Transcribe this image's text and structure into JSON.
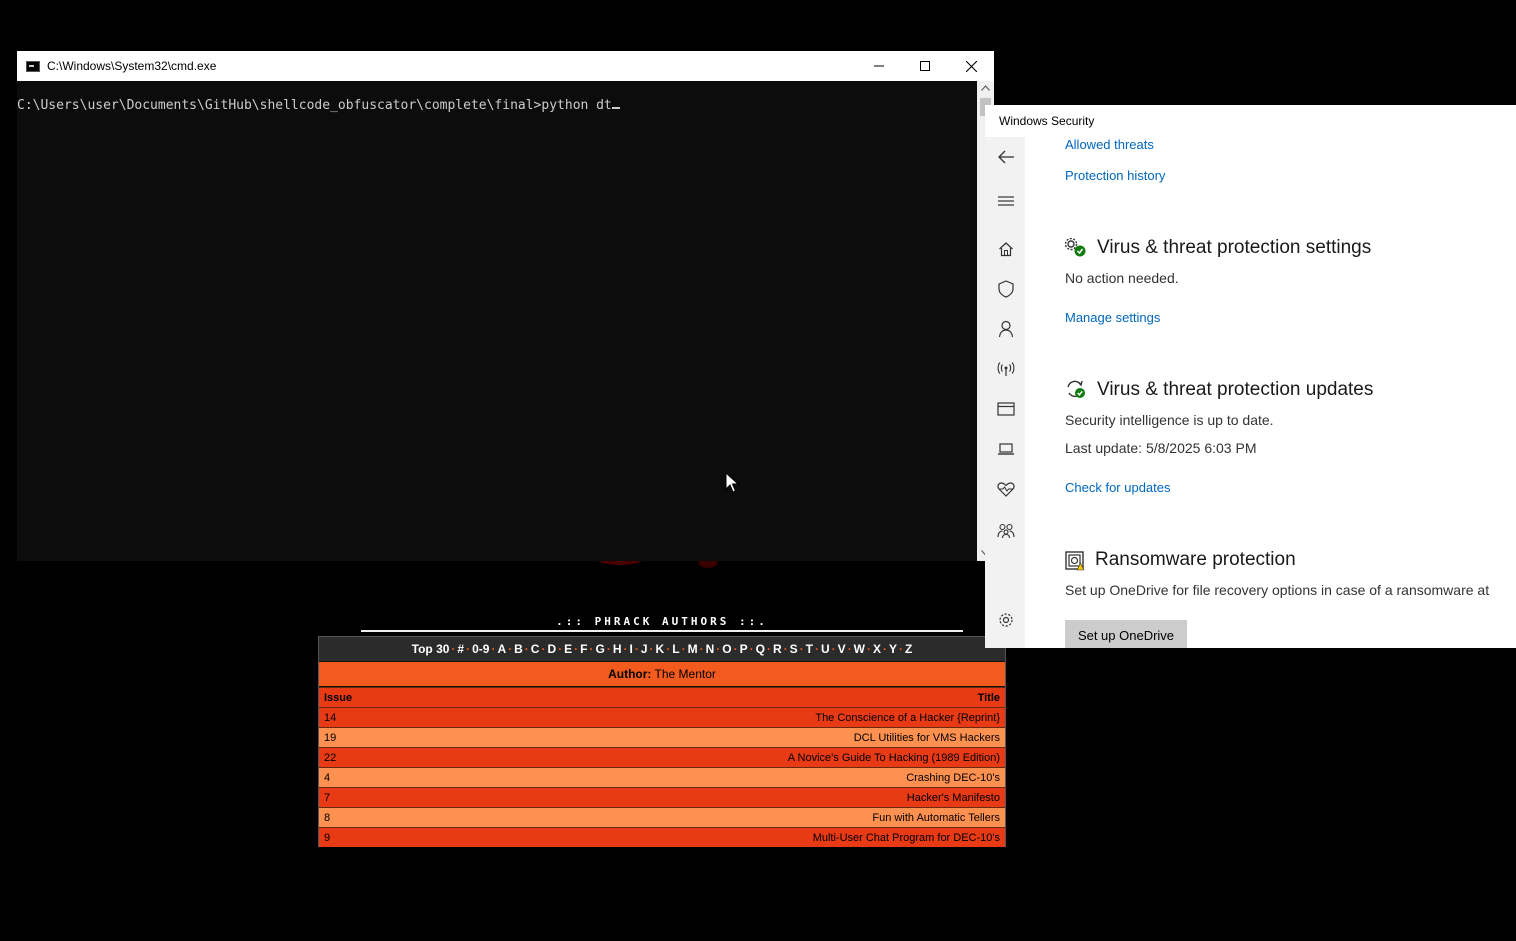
{
  "cmd": {
    "title": "C:\\Windows\\System32\\cmd.exe",
    "prompt": "C:\\Users\\user\\Documents\\GitHub\\shellcode_obfuscator\\complete\\final>",
    "typed": "python dt",
    "buttons": {
      "minimize": "─",
      "maximize": "☐",
      "close": "✕"
    }
  },
  "winsec": {
    "title": "Windows Security",
    "links_top": [
      "Allowed threats",
      "Protection history"
    ],
    "settings": {
      "heading": "Virus & threat protection settings",
      "status": "No action needed.",
      "link": "Manage settings"
    },
    "updates": {
      "heading": "Virus & threat protection updates",
      "status": "Security intelligence is up to date.",
      "last_update": "Last update: 5/8/2025 6:03 PM",
      "link": "Check for updates"
    },
    "ransomware": {
      "heading": "Ransomware protection",
      "text": "Set up OneDrive for file recovery options in case of a ransomware at",
      "button": "Set up OneDrive"
    },
    "nav_icons": [
      "back-arrow-icon",
      "hamburger-menu-icon",
      "home-icon",
      "shield-icon",
      "account-person-icon",
      "firewall-network-icon",
      "app-browser-control-icon",
      "device-security-laptop-icon",
      "device-health-heart-icon",
      "family-options-icon",
      "settings-gear-icon"
    ]
  },
  "phrack": {
    "heading": ".:: PHRACK AUTHORS ::.",
    "nav": [
      "Top 30",
      "#",
      "0-9",
      "A",
      "B",
      "C",
      "D",
      "E",
      "F",
      "G",
      "H",
      "I",
      "J",
      "K",
      "L",
      "M",
      "N",
      "O",
      "P",
      "Q",
      "R",
      "S",
      "T",
      "U",
      "V",
      "W",
      "X",
      "Y",
      "Z"
    ],
    "author_label": "Author:",
    "author_name": "The Mentor",
    "col_issue": "Issue",
    "col_title": "Title",
    "rows": [
      {
        "issue": "14",
        "title": "The Conscience of a Hacker {Reprint}"
      },
      {
        "issue": "19",
        "title": "DCL Utilities for VMS Hackers"
      },
      {
        "issue": "22",
        "title": "A Novice's Guide To Hacking (1989 Edition)"
      },
      {
        "issue": "4",
        "title": "Crashing DEC-10's"
      },
      {
        "issue": "7",
        "title": "Hacker's Manifesto"
      },
      {
        "issue": "8",
        "title": "Fun with Automatic Tellers"
      },
      {
        "issue": "9",
        "title": "Multi-User Chat Program for DEC-10's"
      }
    ]
  },
  "colors": {
    "accent_link": "#0067c0",
    "phrack_orange": "#f25a1e",
    "phrack_row_dark": "#e83a14",
    "phrack_row_light": "#ff9150"
  }
}
